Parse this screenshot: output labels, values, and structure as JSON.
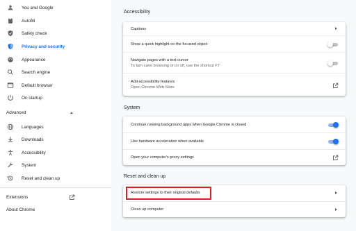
{
  "sidebar": {
    "items": [
      {
        "label": "You and Google",
        "icon": "person-icon"
      },
      {
        "label": "Autofill",
        "icon": "clipboard-icon"
      },
      {
        "label": "Safety check",
        "icon": "shield-check-icon"
      },
      {
        "label": "Privacy and security",
        "icon": "shield-icon",
        "active": true
      },
      {
        "label": "Appearance",
        "icon": "palette-icon"
      },
      {
        "label": "Search engine",
        "icon": "search-icon"
      },
      {
        "label": "Default browser",
        "icon": "browser-icon"
      },
      {
        "label": "On startup",
        "icon": "power-icon"
      }
    ],
    "advanced_label": "Advanced",
    "advanced_items": [
      {
        "label": "Languages",
        "icon": "globe-icon"
      },
      {
        "label": "Downloads",
        "icon": "download-icon"
      },
      {
        "label": "Accessibility",
        "icon": "accessibility-icon"
      },
      {
        "label": "System",
        "icon": "wrench-icon"
      },
      {
        "label": "Reset and clean up",
        "icon": "history-icon"
      }
    ],
    "extensions_label": "Extensions",
    "about_label": "About Chrome"
  },
  "accessibility": {
    "title": "Accessibility",
    "captions": "Captions",
    "highlight": "Show a quick highlight on the focused object",
    "caret": "Navigate pages with a text cursor",
    "caret_sub": "To turn caret browsing on or off, use the shortcut F7",
    "add_features": "Add accessibility features",
    "add_features_sub": "Open Chrome Web Store"
  },
  "system": {
    "title": "System",
    "background_apps": "Continue running background apps when Google Chrome is closed",
    "hardware_accel": "Use hardware acceleration when available",
    "proxy": "Open your computer's proxy settings"
  },
  "reset": {
    "title": "Reset and clean up",
    "restore": "Restore settings to their original defaults",
    "cleanup": "Clean up computer"
  },
  "toggles": {
    "highlight": false,
    "caret": false,
    "background_apps": true,
    "hardware_accel": true
  },
  "colors": {
    "accent": "#1a73e8",
    "highlight_box": "#e01b24"
  }
}
